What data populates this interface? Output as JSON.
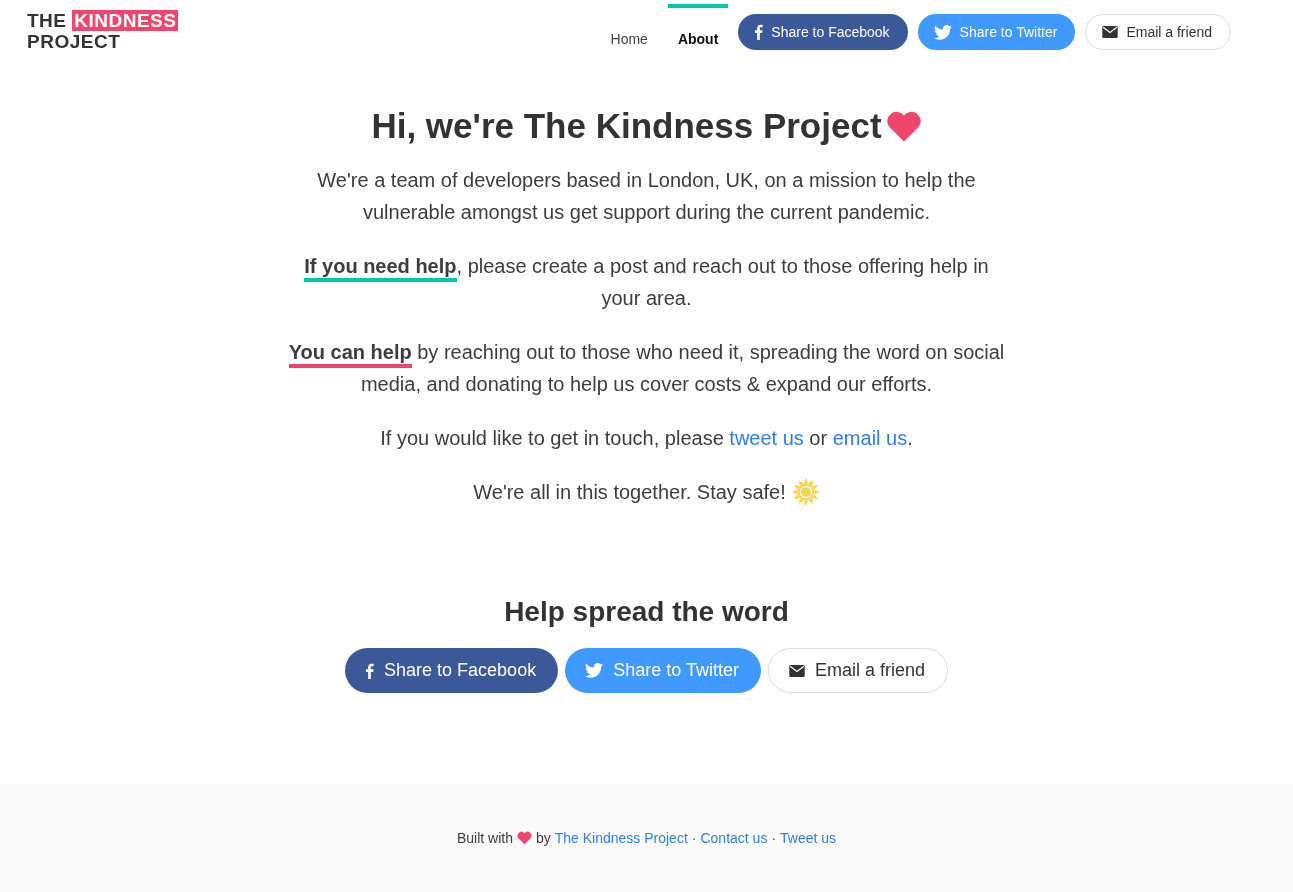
{
  "logo": {
    "line_1_start": "THE",
    "line_1_highlight": "KINDNESS",
    "line_2": "PROJECT"
  },
  "nav": [
    {
      "label": "Home",
      "selected": false
    },
    {
      "label": "About",
      "selected": true
    }
  ],
  "header_share_buttons": [
    {
      "kind": "facebook",
      "label": "Share to Facebook"
    },
    {
      "kind": "twitter",
      "label": "Share to Twitter"
    },
    {
      "kind": "email",
      "label": "Email a friend"
    }
  ],
  "heading": "Hi, we're The Kindness Project",
  "paragraphs": [
    {
      "segments": [
        {
          "kind": "text",
          "text": "We're a team of developers based in London, UK, on a mission to help the vulnerable amongst us get support during the current pandemic."
        }
      ]
    },
    {
      "segments": [
        {
          "kind": "highlight",
          "text": "If you need help",
          "color": "#00c9a7"
        },
        {
          "kind": "text",
          "text": ", please create a post and reach out to those offering help in your area."
        }
      ]
    },
    {
      "segments": [
        {
          "kind": "highlight",
          "text": "You can help",
          "color": "#f0466e"
        },
        {
          "kind": "text",
          "text": " by reaching out to those who need it, spreading the word on social media, and donating to help us cover costs & expand our efforts."
        }
      ]
    },
    {
      "segments": [
        {
          "kind": "text",
          "text": "If you would like to get in touch, please "
        },
        {
          "kind": "link",
          "text": "tweet us"
        },
        {
          "kind": "text",
          "text": " or "
        },
        {
          "kind": "link",
          "text": "email us"
        },
        {
          "kind": "text",
          "text": "."
        }
      ]
    },
    {
      "segments": [
        {
          "kind": "text",
          "text": "We're all in this together. Stay safe!"
        },
        {
          "kind": "sun"
        }
      ]
    }
  ],
  "spread": {
    "title": "Help spread the word",
    "buttons": [
      {
        "kind": "facebook",
        "label": "Share to Facebook"
      },
      {
        "kind": "twitter",
        "label": "Share to Twitter"
      },
      {
        "kind": "email",
        "label": "Email a friend"
      }
    ]
  },
  "footer": {
    "before_heart": "Built with",
    "after_heart": "by",
    "links": [
      "The Kindness Project",
      "Contact us",
      "Tweet us"
    ],
    "separator": "·"
  }
}
